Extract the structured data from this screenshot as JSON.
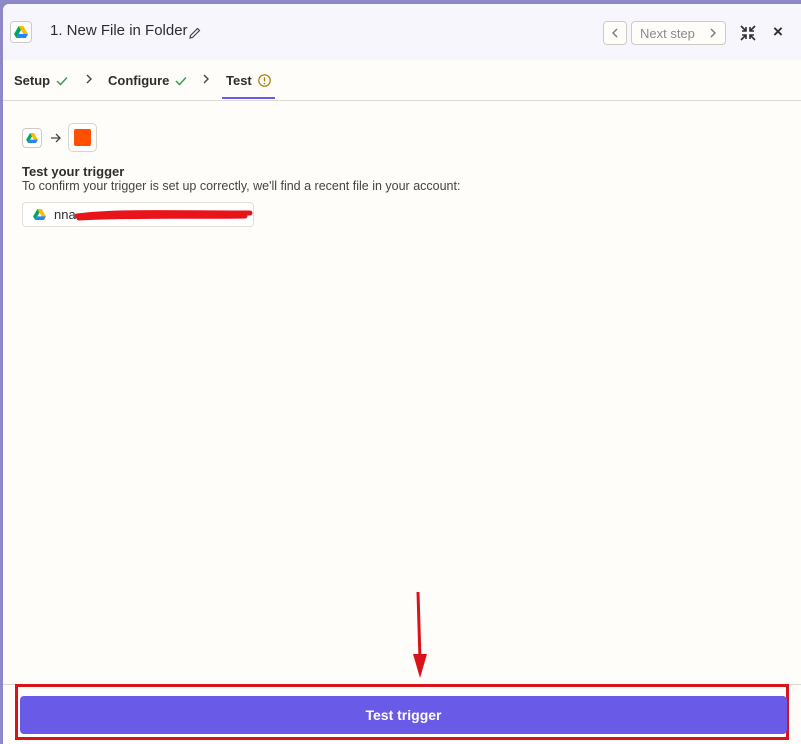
{
  "header": {
    "title": "1. New File in Folder",
    "next_step_label": "Next step",
    "close_glyph": "×"
  },
  "tabs": [
    {
      "label": "Setup",
      "status": "complete"
    },
    {
      "label": "Configure",
      "status": "complete"
    },
    {
      "label": "Test",
      "status": "warning"
    }
  ],
  "test_section": {
    "heading": "Test your trigger",
    "description": "To confirm your trigger is set up correctly, we'll find a recent file in your account:",
    "account_label_visible": "nna"
  },
  "footer": {
    "test_button_label": "Test trigger"
  },
  "colors": {
    "accent": "#695be8",
    "brand_orange": "#ff4f00",
    "annotation_red": "#d8141a",
    "check_green": "#3a9d51"
  },
  "icons": [
    "google-drive-icon",
    "pencil-icon",
    "chevron-left-icon",
    "chevron-right-icon",
    "collapse-icon",
    "close-icon",
    "check-icon",
    "warning-circle-icon",
    "arrow-right-icon"
  ]
}
